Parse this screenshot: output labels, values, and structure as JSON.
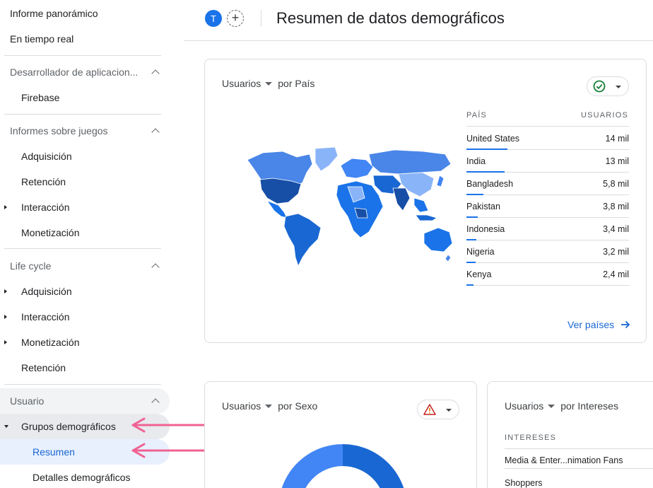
{
  "sidebar": {
    "top_items": [
      "Informe panorámico",
      "En tiempo real"
    ],
    "sections": [
      {
        "title": "Desarrollador de aplicacion...",
        "items": [
          "Firebase"
        ]
      },
      {
        "title": "Informes sobre juegos",
        "items": [
          "Adquisición",
          "Retención",
          "Interacción",
          "Monetización"
        ]
      },
      {
        "title": "Life cycle",
        "items": [
          "Adquisición",
          "Interacción",
          "Monetización",
          "Retención"
        ]
      },
      {
        "title": "Usuario",
        "items": [
          "Grupos demográficos",
          "Resumen",
          "Detalles demográficos"
        ]
      }
    ]
  },
  "header": {
    "avatar_letter": "T",
    "add_symbol": "+",
    "title": "Resumen de datos demográficos"
  },
  "country_card": {
    "metric": "Usuarios",
    "dimension": "por País",
    "col_country": "PAÍS",
    "col_users": "USUARIOS",
    "rows": [
      {
        "country": "United States",
        "users": "14 mil",
        "share": 1.0
      },
      {
        "country": "India",
        "users": "13 mil",
        "share": 0.93
      },
      {
        "country": "Bangladesh",
        "users": "5,8 mil",
        "share": 0.41
      },
      {
        "country": "Pakistan",
        "users": "3,8 mil",
        "share": 0.27
      },
      {
        "country": "Indonesia",
        "users": "3,4 mil",
        "share": 0.24
      },
      {
        "country": "Nigeria",
        "users": "3,2 mil",
        "share": 0.23
      },
      {
        "country": "Kenya",
        "users": "2,4 mil",
        "share": 0.17
      }
    ],
    "link_label": "Ver países",
    "status": "check"
  },
  "gender_card": {
    "metric": "Usuarios",
    "dimension": "por Sexo",
    "status": "warning"
  },
  "interests_card": {
    "metric": "Usuarios",
    "dimension": "por Intereses",
    "col_interests": "INTERESES",
    "rows": [
      "Media & Enter...nimation Fans",
      "Shoppers"
    ]
  },
  "colors": {
    "accent": "#1a73e8",
    "active_bg": "#e8f0fe",
    "annotation_arrow": "#f06292"
  }
}
